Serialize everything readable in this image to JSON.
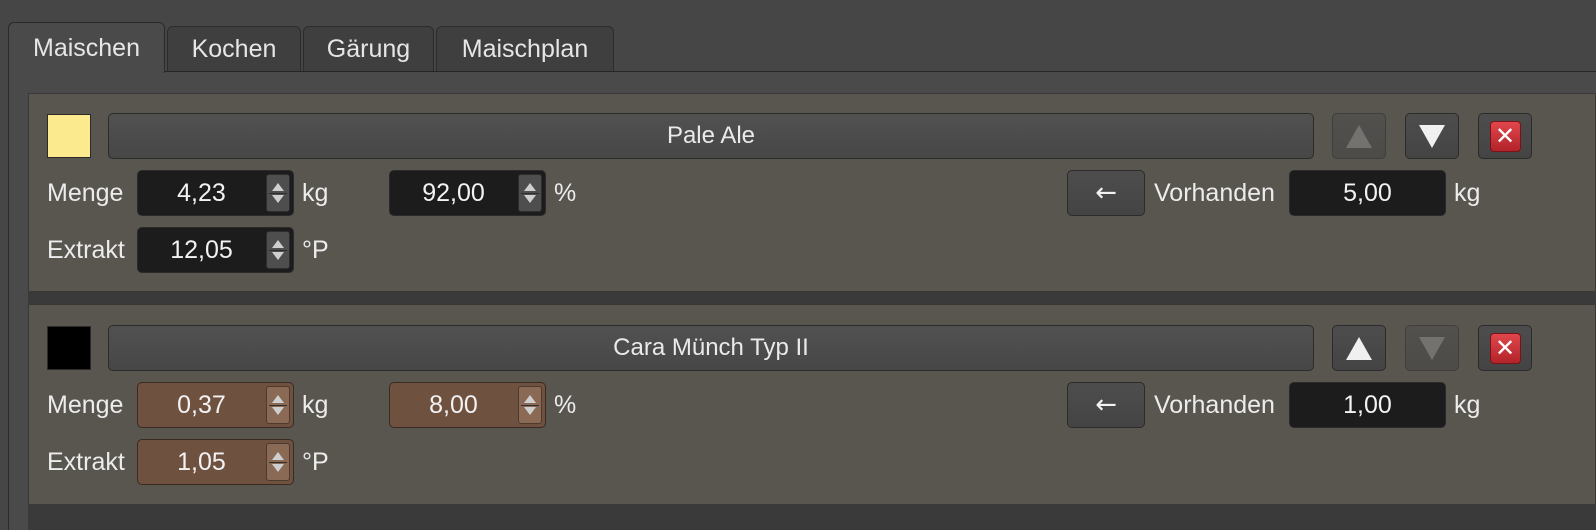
{
  "tabs": [
    {
      "label": "Maischen",
      "active": true
    },
    {
      "label": "Kochen",
      "active": false
    },
    {
      "label": "Gärung",
      "active": false
    },
    {
      "label": "Maischplan",
      "active": false
    }
  ],
  "ingredients": [
    {
      "color": "#fcea8f",
      "name": "Pale Ale",
      "menge_label": "Menge",
      "menge_value": "4,23",
      "menge_unit": "kg",
      "percent_value": "92,00",
      "percent_unit": "%",
      "transfer_icon": "←",
      "vorhanden_label": "Vorhanden",
      "vorhanden_value": "5,00",
      "vorhanden_unit": "kg",
      "extrakt_label": "Extrakt",
      "extrakt_value": "12,05",
      "extrakt_unit": "°P",
      "move_up_enabled": false,
      "move_down_enabled": true,
      "delete_icon": "✕",
      "highlight": false
    },
    {
      "color": "#000000",
      "name": "Cara Münch Typ II",
      "menge_label": "Menge",
      "menge_value": "0,37",
      "menge_unit": "kg",
      "percent_value": "8,00",
      "percent_unit": "%",
      "transfer_icon": "←",
      "vorhanden_label": "Vorhanden",
      "vorhanden_value": "1,00",
      "vorhanden_unit": "kg",
      "extrakt_label": "Extrakt",
      "extrakt_value": "1,05",
      "extrakt_unit": "°P",
      "move_up_enabled": true,
      "move_down_enabled": false,
      "delete_icon": "✕",
      "highlight": true
    }
  ]
}
